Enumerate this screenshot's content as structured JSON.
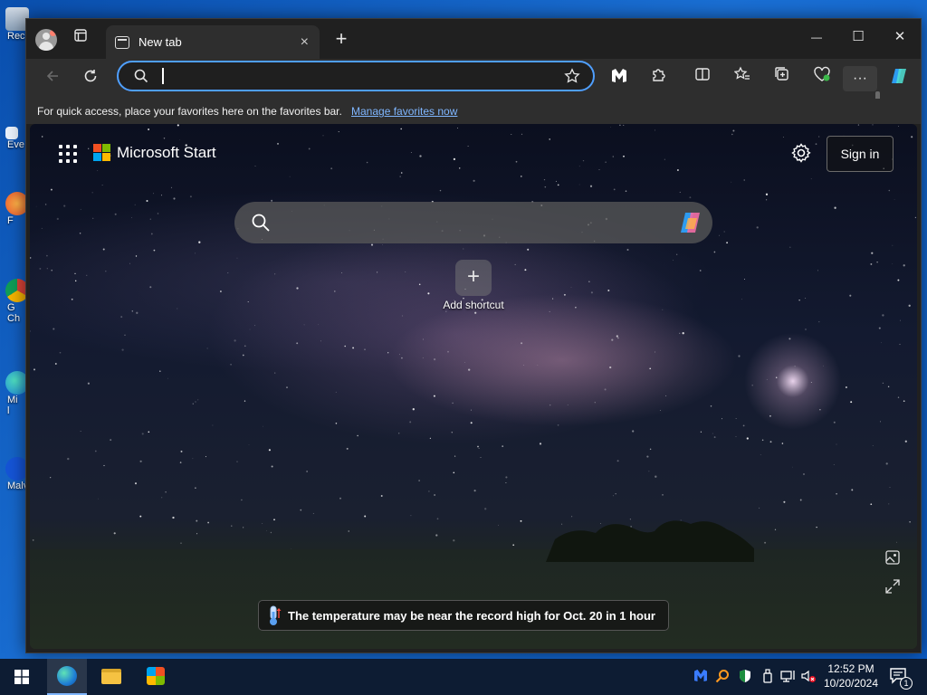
{
  "desktop": {
    "icons": [
      {
        "label": "Rec"
      },
      {
        "label": "Eve"
      },
      {
        "label": "F"
      },
      {
        "label": "G"
      },
      {
        "label": "Ch"
      },
      {
        "label": "Mi"
      },
      {
        "label": "l"
      },
      {
        "label": "Malv"
      }
    ]
  },
  "browser": {
    "tab": {
      "title": "New tab",
      "close": "×"
    },
    "new_tab_symbol": "+",
    "window_controls": {
      "minimize": "—",
      "maximize": "☐",
      "close": "✕"
    },
    "address_bar": {
      "value": "",
      "placeholder": ""
    },
    "more_label": "···",
    "favorites_bar": {
      "message": "For quick access, place your favorites here on the favorites bar.",
      "link": "Manage favorites now"
    }
  },
  "start_page": {
    "brand": "Microsoft Start",
    "sign_in": "Sign in",
    "search": {
      "value": "",
      "placeholder": ""
    },
    "add_shortcut": {
      "symbol": "+",
      "label": "Add shortcut"
    },
    "banner": "The temperature may be near the record high for Oct. 20 in 1 hour"
  },
  "taskbar": {
    "time": "12:52 PM",
    "date": "10/20/2024",
    "notification_count": "1"
  },
  "colors": {
    "accent": "#4f9fff",
    "link": "#7fb6ff",
    "chrome_dark": "#202020",
    "toolbar": "#2e2e2e",
    "taskbar": "#0d1c33"
  }
}
